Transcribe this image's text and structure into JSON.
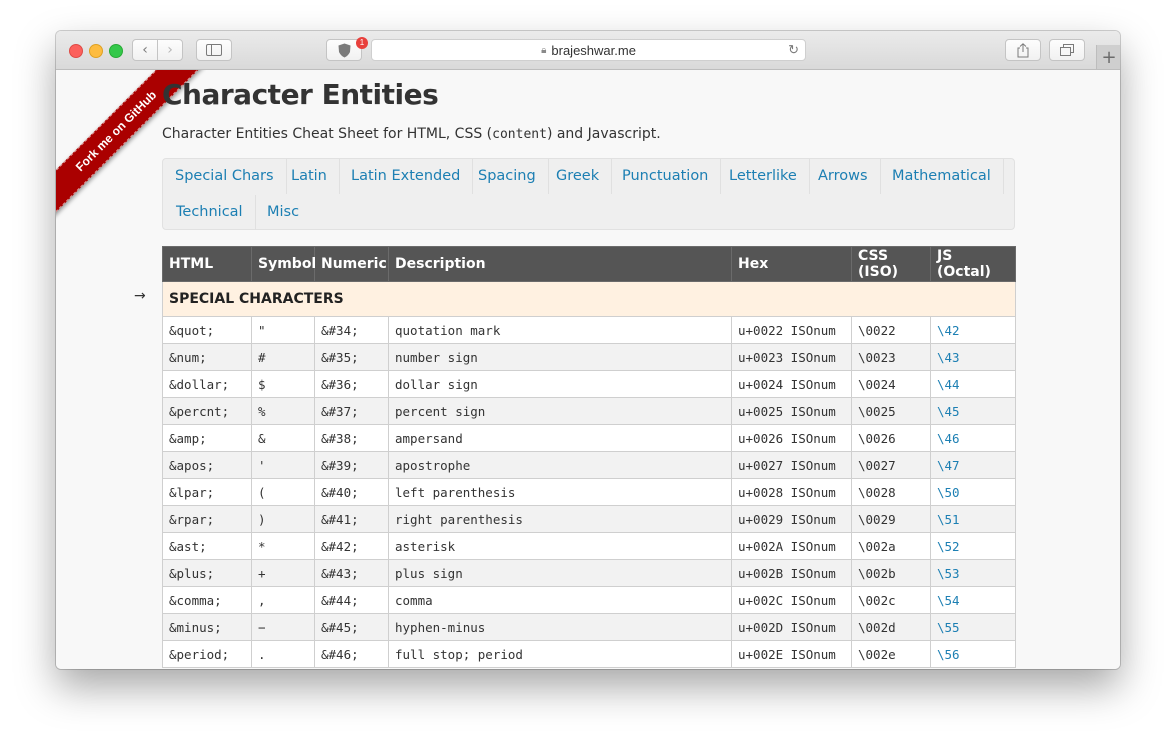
{
  "browser": {
    "url": "brajeshwar.me",
    "extension_badge": "1"
  },
  "ribbon": {
    "label": "Fork me on GitHub"
  },
  "page": {
    "title": "Character Entities",
    "subtitle_before": "Character Entities Cheat Sheet for HTML, CSS (",
    "subtitle_code": "content",
    "subtitle_after": ") and Javascript."
  },
  "nav": {
    "items": [
      "Special Chars",
      "Latin",
      "Latin Extended",
      "Spacing",
      "Greek",
      "Punctuation",
      "Letterlike",
      "Arrows",
      "Mathematical",
      "Technical",
      "Misc"
    ]
  },
  "table": {
    "headers": [
      "HTML",
      "Symbol",
      "Numeric",
      "Description",
      "Hex",
      "CSS (ISO)",
      "JS (Octal)"
    ],
    "section_marker": "→",
    "section_title": "SPECIAL CHARACTERS",
    "rows": [
      [
        "&quot;",
        "\"",
        "&#34;",
        "quotation mark",
        "u+0022 ISOnum",
        "\\0022",
        "\\42"
      ],
      [
        "&num;",
        "#",
        "&#35;",
        "number sign",
        "u+0023 ISOnum",
        "\\0023",
        "\\43"
      ],
      [
        "&dollar;",
        "$",
        "&#36;",
        "dollar sign",
        "u+0024 ISOnum",
        "\\0024",
        "\\44"
      ],
      [
        "&percnt;",
        "%",
        "&#37;",
        "percent sign",
        "u+0025 ISOnum",
        "\\0025",
        "\\45"
      ],
      [
        "&amp;",
        "&",
        "&#38;",
        "ampersand",
        "u+0026 ISOnum",
        "\\0026",
        "\\46"
      ],
      [
        "&apos;",
        "'",
        "&#39;",
        "apostrophe",
        "u+0027 ISOnum",
        "\\0027",
        "\\47"
      ],
      [
        "&lpar;",
        "(",
        "&#40;",
        "left parenthesis",
        "u+0028 ISOnum",
        "\\0028",
        "\\50"
      ],
      [
        "&rpar;",
        ")",
        "&#41;",
        "right parenthesis",
        "u+0029 ISOnum",
        "\\0029",
        "\\51"
      ],
      [
        "&ast;",
        "*",
        "&#42;",
        "asterisk",
        "u+002A ISOnum",
        "\\002a",
        "\\52"
      ],
      [
        "&plus;",
        "+",
        "&#43;",
        "plus sign",
        "u+002B ISOnum",
        "\\002b",
        "\\53"
      ],
      [
        "&comma;",
        ",",
        "&#44;",
        "comma",
        "u+002C ISOnum",
        "\\002c",
        "\\54"
      ],
      [
        "&minus;",
        "−",
        "&#45;",
        "hyphen-minus",
        "u+002D ISOnum",
        "\\002d",
        "\\55"
      ],
      [
        "&period;",
        ".",
        "&#46;",
        "full stop; period",
        "u+002E ISOnum",
        "\\002e",
        "\\56"
      ]
    ]
  }
}
